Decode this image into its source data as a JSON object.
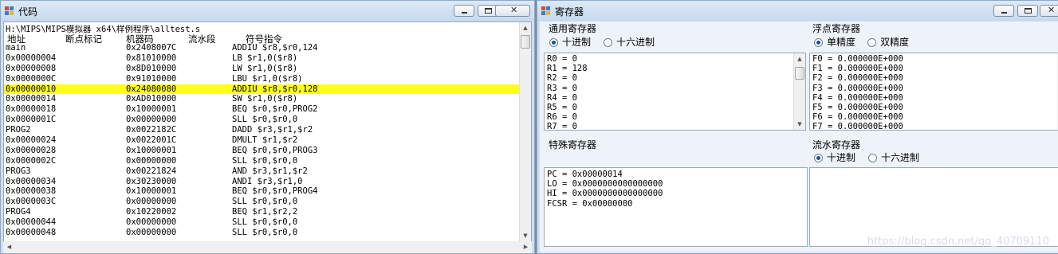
{
  "code_window": {
    "title": "代码",
    "path": "H:\\MIPS\\MIPS模拟器 x64\\样例程序\\alltest.s",
    "columns": {
      "address": "地址",
      "breakpoint": "断点标记",
      "machine_code": "机器码",
      "pipeline": "流水段",
      "instruction": "符号指令"
    },
    "rows": [
      {
        "addr": "main",
        "code": "0x2408007C",
        "instr": "ADDIU $r8,$r0,124"
      },
      {
        "addr": "0x00000004",
        "code": "0x81010000",
        "instr": "LB $r1,0($r8)"
      },
      {
        "addr": "0x00000008",
        "code": "0x8D010000",
        "instr": "LW $r1,0($r8)"
      },
      {
        "addr": "0x0000000C",
        "code": "0x91010000",
        "instr": "LBU $r1,0($r8)"
      },
      {
        "addr": "0x00000010",
        "code": "0x24080080",
        "instr": "ADDIU $r8,$r0,128",
        "highlighted": true
      },
      {
        "addr": "0x00000014",
        "code": "0xAD010000",
        "instr": "SW $r1,0($r8)"
      },
      {
        "addr": "0x00000018",
        "code": "0x10000001",
        "instr": "BEQ $r0,$r0,PROG2"
      },
      {
        "addr": "0x0000001C",
        "code": "0x00000000",
        "instr": "SLL $r0,$r0,0"
      },
      {
        "addr": "PROG2",
        "code": "0x0022182C",
        "instr": "DADD $r3,$r1,$r2"
      },
      {
        "addr": "0x00000024",
        "code": "0x0022001C",
        "instr": "DMULT $r1,$r2"
      },
      {
        "addr": "0x00000028",
        "code": "0x10000001",
        "instr": "BEQ $r0,$r0,PROG3"
      },
      {
        "addr": "0x0000002C",
        "code": "0x00000000",
        "instr": "SLL $r0,$r0,0"
      },
      {
        "addr": "PROG3",
        "code": "0x00221824",
        "instr": "AND $r3,$r1,$r2"
      },
      {
        "addr": "0x00000034",
        "code": "0x30230000",
        "instr": "ANDI $r3,$r1,0"
      },
      {
        "addr": "0x00000038",
        "code": "0x10000001",
        "instr": "BEQ $r0,$r0,PROG4"
      },
      {
        "addr": "0x0000003C",
        "code": "0x00000000",
        "instr": "SLL $r0,$r0,0"
      },
      {
        "addr": "PROG4",
        "code": "0x10220002",
        "instr": "BEQ $r1,$r2,2"
      },
      {
        "addr": "0x00000044",
        "code": "0x00000000",
        "instr": "SLL $r0,$r0,0"
      },
      {
        "addr": "0x00000048",
        "code": "0x00000000",
        "instr": "SLL $r0,$r0,0"
      }
    ]
  },
  "register_window": {
    "title": "寄存器",
    "general": {
      "title": "通用寄存器",
      "radio_dec": "十进制",
      "radio_hex": "十六进制",
      "selected": "dec",
      "values": [
        "R0 = 0",
        "R1 = 128",
        "R2 = 0",
        "R3 = 0",
        "R4 = 0",
        "R5 = 0",
        "R6 = 0",
        "R7 = 0"
      ]
    },
    "float": {
      "title": "浮点寄存器",
      "radio_single": "单精度",
      "radio_double": "双精度",
      "selected": "single",
      "values": [
        "F0 = 0.000000E+000",
        "F1 = 0.000000E+000",
        "F2 = 0.000000E+000",
        "F3 = 0.000000E+000",
        "F4 = 0.000000E+000",
        "F5 = 0.000000E+000",
        "F6 = 0.000000E+000",
        "F7 = 0.000000E+000"
      ]
    },
    "special": {
      "title": "特殊寄存器",
      "values": [
        "PC = 0x00000014",
        "LO = 0x0000000000000000",
        "HI = 0x0000000000000000",
        "FCSR = 0x00000000"
      ]
    },
    "pipeline": {
      "title": "流水寄存器",
      "radio_dec": "十进制",
      "radio_hex": "十六进制",
      "selected": "dec"
    }
  },
  "watermark": "https://blog.csdn.net/qq_40709110",
  "colors": {
    "highlight_row": "#ffff1a",
    "title_bar": "#c6d9ee",
    "radio_selected": "#1d4f91"
  },
  "icons": [
    "app-icon",
    "minimize-icon",
    "maximize-icon",
    "close-icon",
    "scroll-up-icon",
    "scroll-down-icon",
    "scroll-left-icon",
    "scroll-right-icon"
  ]
}
